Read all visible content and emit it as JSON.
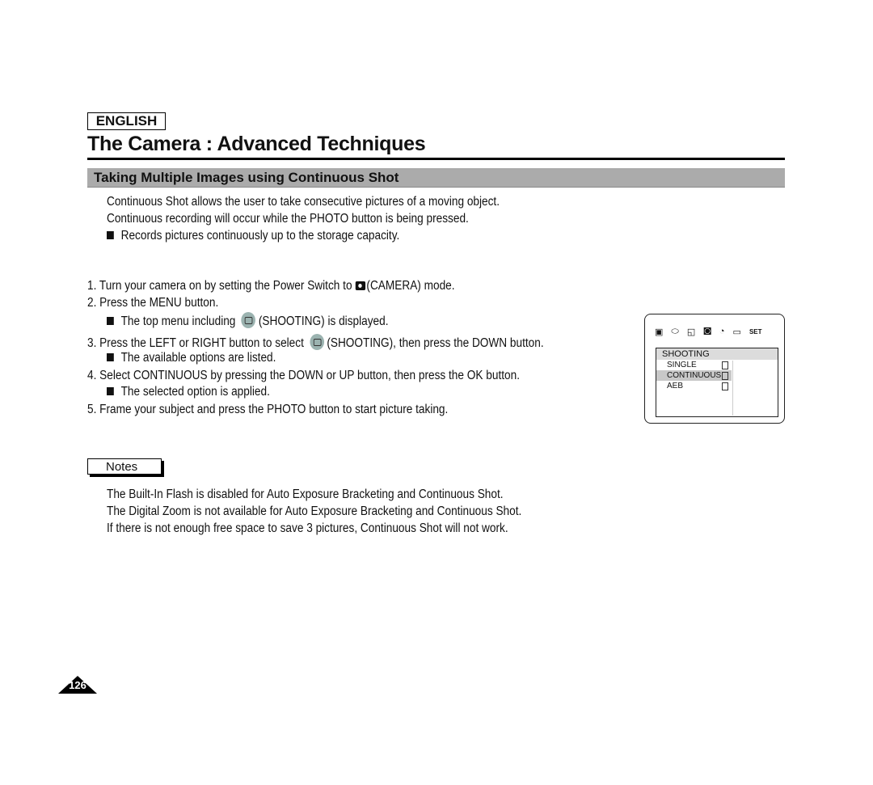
{
  "header": {
    "language": "ENGLISH",
    "title": "The Camera : Advanced Techniques"
  },
  "section": {
    "title": "Taking Multiple Images using Continuous Shot"
  },
  "intro": [
    "Continuous Shot allows the user to take consecutive pictures of a moving object.",
    "Continuous recording will occur while the PHOTO button is being pressed."
  ],
  "intro_bullet": "Records pictures continuously up to the storage capacity.",
  "steps": [
    {
      "num": "1.",
      "pre": "Turn your camera on by setting the Power Switch to ",
      "post": "(CAMERA) mode."
    },
    {
      "num": "2.",
      "text": "Press the MENU button."
    },
    {
      "bullet_pre": "The top menu including ",
      "bullet_post": "(SHOOTING) is displayed."
    },
    {
      "num": "3.",
      "pre": "Press the LEFT or RIGHT button to select ",
      "post": "(SHOOTING), then press the DOWN button."
    },
    {
      "bullet": "The available options are listed."
    },
    {
      "num": "4.",
      "text": "Select CONTINUOUS by pressing the DOWN or UP button, then press the OK button."
    },
    {
      "bullet": "The selected option is applied."
    },
    {
      "num": "5.",
      "text": "Frame your subject and press the PHOTO button to start picture taking."
    }
  ],
  "notes": {
    "label": "Notes",
    "items": [
      "The Built-In Flash is disabled for Auto Exposure Bracketing and Continuous Shot.",
      "The Digital Zoom is not available for Auto Exposure Bracketing and Continuous Shot.",
      "If there is not enough free space to save 3 pictures, Continuous Shot will not work."
    ]
  },
  "lcd": {
    "top_icons": [
      "image-icon",
      "color-icon",
      "size-icon",
      "shooting-icon",
      "timer-icon",
      "card-icon",
      "SET"
    ],
    "menu_title": "SHOOTING",
    "options": [
      "SINGLE",
      "CONTINUOUS",
      "AEB"
    ],
    "selected": "CONTINUOUS"
  },
  "page_number": "126"
}
